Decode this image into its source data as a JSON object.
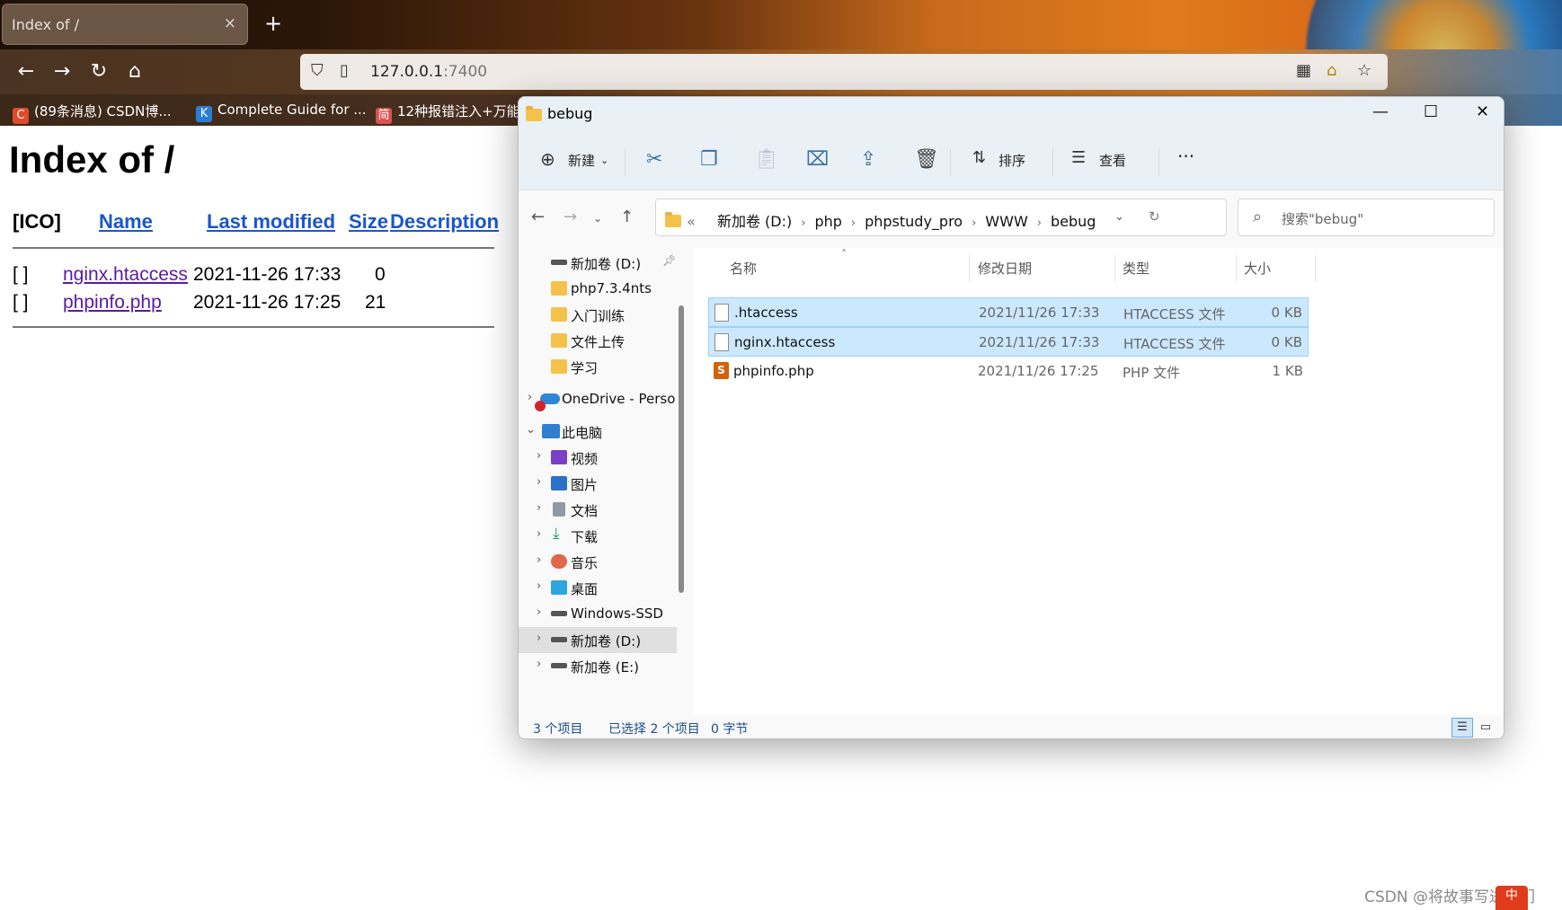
{
  "browser": {
    "tab_title": "Index of /",
    "tab_close": "×",
    "new_tab": "+",
    "url_host": "127.0.0.1",
    "url_port": ":7400",
    "bookmarks": [
      {
        "label": "(89条消息) CSDN博...",
        "icon": "C",
        "color": "#e04a2a"
      },
      {
        "label": "Complete Guide for ...",
        "icon": "K",
        "color": "#2a7ed0"
      },
      {
        "label": "12种报错注入+万能...",
        "icon": "简",
        "color": "#d9534f"
      }
    ]
  },
  "index_page": {
    "title": "Index of /",
    "headers": {
      "ico": "[ICO]",
      "name": "Name",
      "last_modified": "Last modified",
      "size": "Size",
      "description": "Description"
    },
    "rows": [
      {
        "ico": "[ ]",
        "name": "nginx.htaccess",
        "modified": "2021-11-26 17:33",
        "size": "0"
      },
      {
        "ico": "[ ]",
        "name": "phpinfo.php",
        "modified": "2021-11-26 17:25",
        "size": "21"
      }
    ]
  },
  "explorer": {
    "window_title": "bebug",
    "toolbar": {
      "new": "新建",
      "sort": "排序",
      "view": "查看",
      "more": "···"
    },
    "breadcrumb": [
      "新加卷 (D:)",
      "php",
      "phpstudy_pro",
      "WWW",
      "bebug"
    ],
    "breadcrumb_prefix": "«",
    "search_placeholder": "搜索\"bebug\"",
    "sidebar": [
      {
        "label": "新加卷 (D:)",
        "type": "drive",
        "pinned": true
      },
      {
        "label": "php7.3.4nts",
        "type": "folder"
      },
      {
        "label": "入门训练",
        "type": "folder"
      },
      {
        "label": "文件上传",
        "type": "folder"
      },
      {
        "label": "学习",
        "type": "folder"
      },
      {
        "label": "OneDrive - Perso",
        "type": "cloud"
      },
      {
        "label": "此电脑",
        "type": "pc"
      },
      {
        "label": "视频",
        "type": "video"
      },
      {
        "label": "图片",
        "type": "pictures"
      },
      {
        "label": "文档",
        "type": "documents"
      },
      {
        "label": "下载",
        "type": "downloads"
      },
      {
        "label": "音乐",
        "type": "music"
      },
      {
        "label": "桌面",
        "type": "desktop"
      },
      {
        "label": "Windows-SSD",
        "type": "drive"
      },
      {
        "label": "新加卷 (D:)",
        "type": "drive",
        "selected": true
      },
      {
        "label": "新加卷 (E:)",
        "type": "drive"
      }
    ],
    "columns": {
      "name": "名称",
      "date": "修改日期",
      "type": "类型",
      "size": "大小"
    },
    "files": [
      {
        "name": ".htaccess",
        "date": "2021/11/26 17:33",
        "type": "HTACCESS 文件",
        "size": "0 KB",
        "selected": true,
        "icon": "file"
      },
      {
        "name": "nginx.htaccess",
        "date": "2021/11/26 17:33",
        "type": "HTACCESS 文件",
        "size": "0 KB",
        "selected": true,
        "icon": "file"
      },
      {
        "name": "phpinfo.php",
        "date": "2021/11/26 17:25",
        "type": "PHP 文件",
        "size": "1 KB",
        "selected": false,
        "icon": "php"
      }
    ],
    "status": {
      "count": "3 个项目",
      "selected": "已选择 2 个项目",
      "bytes": "0 字节"
    }
  },
  "watermark": "CSDN @将故事写进我们"
}
